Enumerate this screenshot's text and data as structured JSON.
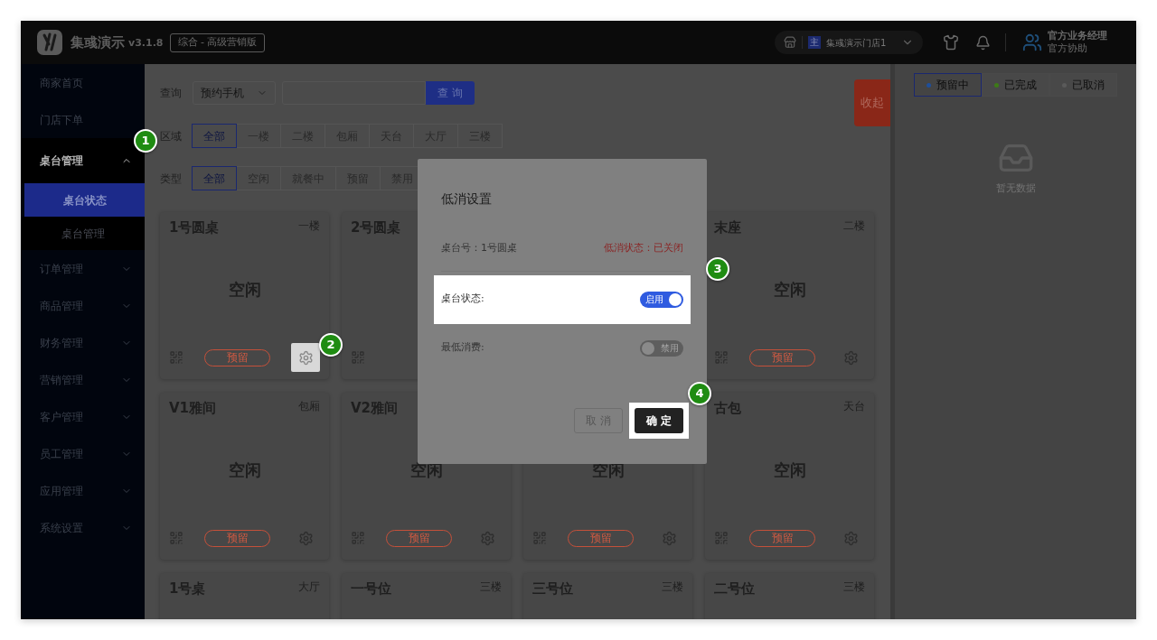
{
  "header": {
    "app_name": "集彧演示",
    "version": "v3.1.8",
    "edition": "综合 - 高级营销版",
    "store": {
      "badge": "主",
      "name": "集彧演示门店1"
    },
    "user": {
      "name": "官方业务经理",
      "role": "官方协助"
    }
  },
  "sidebar": {
    "items": [
      {
        "label": "商家首页",
        "expandable": false,
        "expanded": false
      },
      {
        "label": "门店下单",
        "expandable": false,
        "expanded": false
      },
      {
        "label": "桌台管理",
        "expandable": true,
        "expanded": true,
        "children": [
          {
            "label": "桌台状态",
            "selected": true
          },
          {
            "label": "桌台管理",
            "selected": false
          }
        ]
      },
      {
        "label": "订单管理",
        "expandable": true,
        "expanded": false
      },
      {
        "label": "商品管理",
        "expandable": true,
        "expanded": false
      },
      {
        "label": "财务管理",
        "expandable": true,
        "expanded": false
      },
      {
        "label": "营销管理",
        "expandable": true,
        "expanded": false
      },
      {
        "label": "客户管理",
        "expandable": true,
        "expanded": false
      },
      {
        "label": "员工管理",
        "expandable": true,
        "expanded": false
      },
      {
        "label": "应用管理",
        "expandable": true,
        "expanded": false
      },
      {
        "label": "系统设置",
        "expandable": true,
        "expanded": false
      }
    ]
  },
  "query": {
    "label": "查询",
    "select": "预约手机",
    "button": "查 询"
  },
  "filters": [
    {
      "label": "区域",
      "options": [
        {
          "label": "全部",
          "selected": true
        },
        {
          "label": "一楼",
          "selected": false
        },
        {
          "label": "二楼",
          "selected": false
        },
        {
          "label": "包厢",
          "selected": false
        },
        {
          "label": "天台",
          "selected": false
        },
        {
          "label": "大厅",
          "selected": false
        },
        {
          "label": "三楼",
          "selected": false
        }
      ]
    },
    {
      "label": "类型",
      "options": [
        {
          "label": "全部",
          "selected": true
        },
        {
          "label": "空闲",
          "selected": false
        },
        {
          "label": "就餐中",
          "selected": false
        },
        {
          "label": "预留",
          "selected": false
        },
        {
          "label": "禁用",
          "selected": false
        }
      ]
    }
  ],
  "collapse_button": "收起",
  "cards": [
    {
      "name": "1号圆桌",
      "floor": "一楼",
      "status": "空闲",
      "reserve": "预留",
      "settings_highlighted": true
    },
    {
      "name": "2号圆桌"
    },
    {
      "name": "末座",
      "floor": "二楼",
      "status": "空闲",
      "reserve": "预留",
      "settings_highlighted": false
    },
    {
      "name": "V1雅间",
      "floor": "包厢",
      "status": "空闲",
      "reserve": "预留",
      "settings_highlighted": false
    },
    {
      "name": "V2雅间",
      "status": "空闲",
      "reserve": "预留",
      "settings_highlighted": false
    },
    {
      "status": "空闲",
      "reserve": "预留",
      "settings_highlighted": false
    },
    {
      "name": "古包",
      "floor": "天台",
      "status": "空闲",
      "reserve": "预留",
      "settings_highlighted": false
    },
    {
      "name": "1号桌",
      "floor": "大厅"
    },
    {
      "name": "一号位",
      "floor": "三楼"
    },
    {
      "name": "三号位",
      "floor": "三楼"
    },
    {
      "name": "二号位",
      "floor": "三楼"
    }
  ],
  "right_panel": {
    "tabs": [
      {
        "label": "预留中",
        "selected": true,
        "color": "#1f4f9a"
      },
      {
        "label": "已完成",
        "selected": false,
        "color": "#3d7a17"
      },
      {
        "label": "已取消",
        "selected": false,
        "color": "#5a5a5a"
      }
    ],
    "empty_text": "暂无数据"
  },
  "dialog": {
    "title": "低消设置",
    "table_label": "桌台号：1号圆桌",
    "status_text": "低消状态：已关闭",
    "settings": [
      {
        "label": "桌台状态:",
        "on": true,
        "toggle_text": "启用",
        "highlighted": true
      },
      {
        "label": "最低消费:",
        "on": false,
        "toggle_text": "禁用",
        "highlighted": false
      }
    ],
    "buttons": [
      {
        "label": "取 消",
        "kind": "secondary",
        "highlighted": false
      },
      {
        "label": "确 定",
        "kind": "primary",
        "highlighted": true
      }
    ]
  },
  "step_markers": [
    "1",
    "2",
    "3",
    "4"
  ]
}
